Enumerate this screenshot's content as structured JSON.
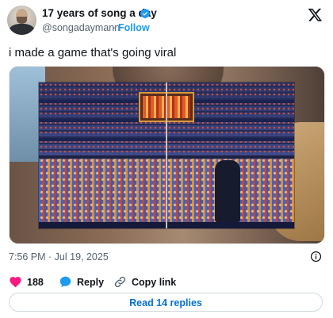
{
  "author": {
    "display_name": "17 years of song a day",
    "handle": "@songadaymann",
    "separator": "·",
    "follow_label": "Follow",
    "verified_color": "#1d9bf0"
  },
  "tweet": {
    "text": "i made a game that's going viral",
    "timestamp": "7:56 PM · Jul 19, 2025"
  },
  "actions": {
    "like_count": "188",
    "reply_label": "Reply",
    "copy_link_label": "Copy link",
    "read_replies_label": "Read 14 replies"
  },
  "icons": {
    "x_logo": "x-logo-icon",
    "verified": "verified-badge-icon",
    "heart": "heart-icon",
    "reply": "reply-bubble-icon",
    "link": "link-icon",
    "info": "info-icon"
  },
  "colors": {
    "accent": "#1d9bf0",
    "heart": "#f91880",
    "muted_text": "#536471",
    "link_text": "#006fd6"
  }
}
